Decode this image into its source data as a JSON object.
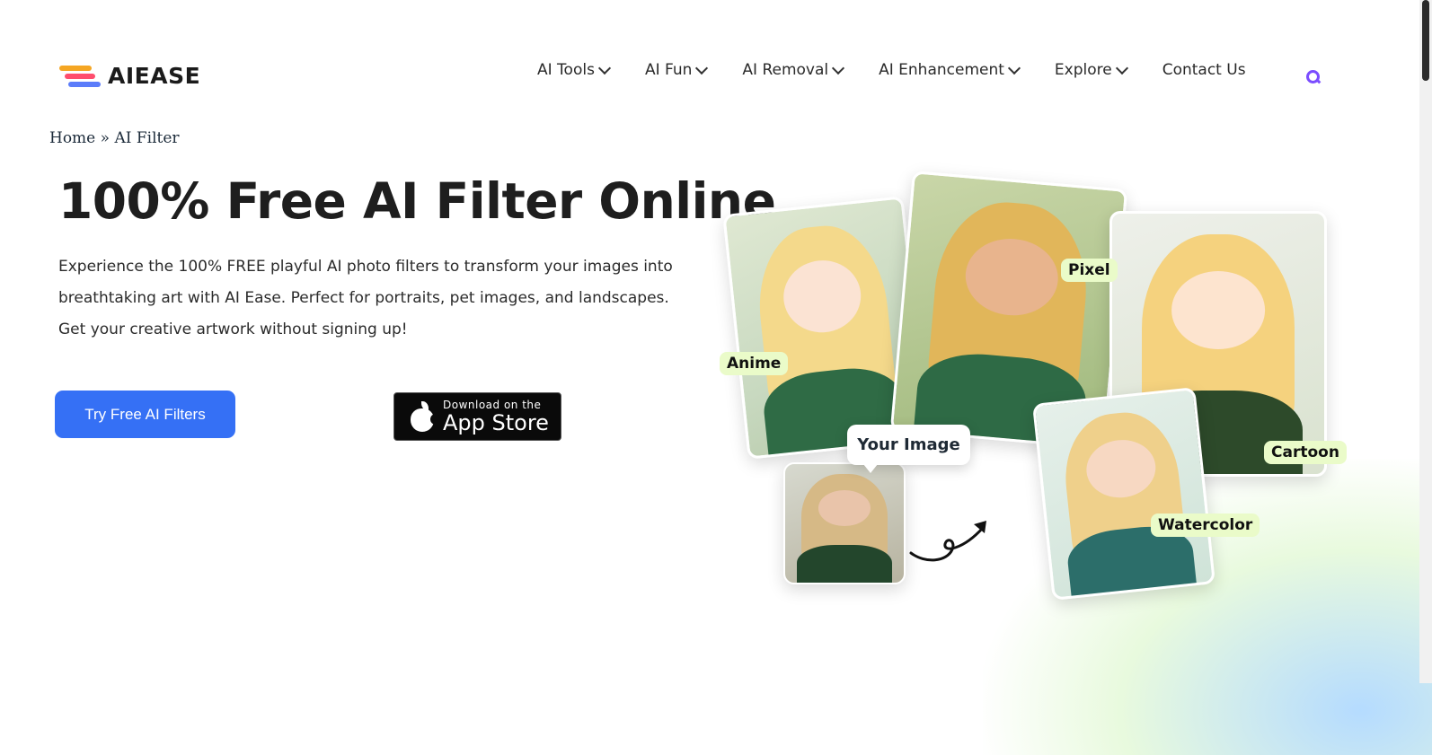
{
  "brand": {
    "name": "AIEASE"
  },
  "nav": {
    "items": [
      {
        "label": "AI Tools"
      },
      {
        "label": "AI Fun"
      },
      {
        "label": "AI Removal"
      },
      {
        "label": "AI Enhancement"
      },
      {
        "label": "Explore"
      }
    ],
    "contact": "Contact Us",
    "search_icon": "search-icon"
  },
  "breadcrumb": {
    "home": "Home",
    "separator": " » ",
    "current": "AI Filter"
  },
  "hero": {
    "title": "100% Free AI Filter Online",
    "description": "Experience the 100% FREE playful AI photo filters to transform your images into breathtaking art with AI Ease. Perfect for portraits, pet images, and landscapes. Get your creative artwork without signing up!",
    "cta_label": "Try Free AI Filters",
    "appstore_small": "Download on the",
    "appstore_big": "App Store"
  },
  "collage": {
    "labels": {
      "anime": "Anime",
      "pixel": "Pixel",
      "cartoon": "Cartoon",
      "watercolor": "Watercolor"
    },
    "your_image": "Your Image"
  },
  "colors": {
    "accent": "#3570f5",
    "tag_bg": "#eafbc9",
    "search": "#7b4dff"
  }
}
